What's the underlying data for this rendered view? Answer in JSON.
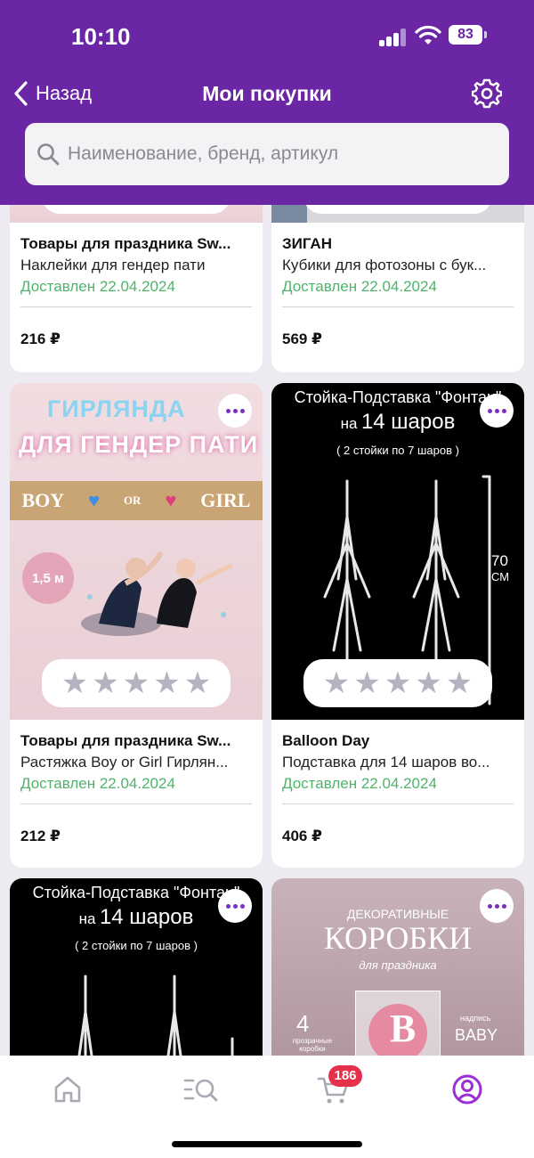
{
  "status_bar": {
    "time": "10:10",
    "battery": "83"
  },
  "nav": {
    "back_label": "Назад",
    "title": "Мои покупки"
  },
  "search": {
    "placeholder": "Наименование, бренд, артикул"
  },
  "products": [
    {
      "brand": "Товары для праздника Sw...",
      "name": "Наклейки для гендер пати",
      "status": "Доставлен 22.04.2024",
      "price": "216 ₽"
    },
    {
      "brand": "ЗИГАН",
      "name": "Кубики для фотозоны с бук...",
      "status": "Доставлен 22.04.2024",
      "price": "569 ₽"
    },
    {
      "brand": "Товары для праздника Sw...",
      "name": "Растяжка Boy or Girl Гирлян...",
      "status": "Доставлен 22.04.2024",
      "price": "212 ₽",
      "rating": 0
    },
    {
      "brand": "Balloon Day",
      "name": "Подставка для 14 шаров во...",
      "status": "Доставлен 22.04.2024",
      "price": "406 ₽",
      "rating": 0
    }
  ],
  "artwork": {
    "garland": {
      "line1": "ГИРЛЯНДА",
      "line2": "ДЛЯ ГЕНДЕР ПАТИ",
      "banner_left": "BOY",
      "banner_or": "OR",
      "banner_right": "GIRL",
      "size": "1,5 м"
    },
    "stand": {
      "line1": "Стойка-Подставка \"Фонтан\"",
      "line2_prefix": "на",
      "line2_main": "14 шаров",
      "line3": "( 2 стойки по 7 шаров )",
      "height": "70",
      "unit": "СМ"
    },
    "boxes": {
      "line1": "ДЕКОРАТИВНЫЕ",
      "line2": "КОРОБКИ",
      "line3": "для праздника",
      "count": "4",
      "count_caption": "прозрачные коробки",
      "letter": "B",
      "word_caption": "надпись",
      "word": "BABY"
    }
  },
  "tabbar": {
    "cart_count": "186"
  },
  "colors": {
    "brand": "#6b26a6",
    "accent": "#7b2fbf",
    "delivered": "#4fb46a",
    "badge": "#e6304b"
  }
}
